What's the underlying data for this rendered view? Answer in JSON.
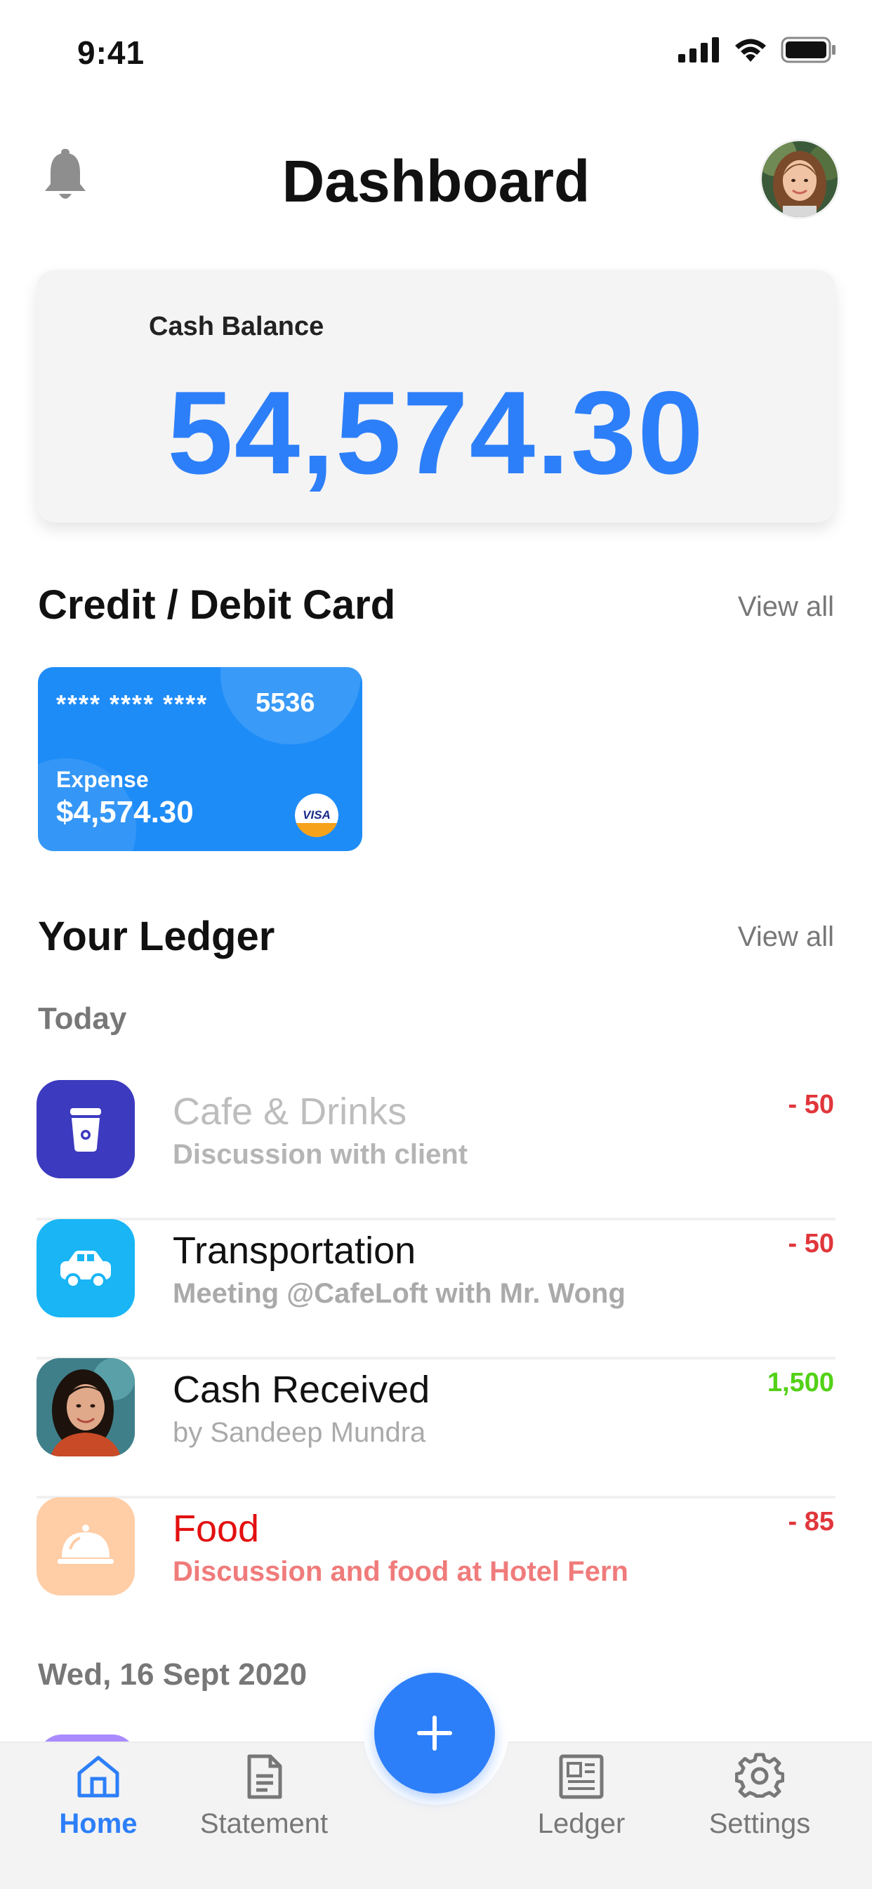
{
  "status_bar": {
    "time": "9:41"
  },
  "header": {
    "title": "Dashboard"
  },
  "balance": {
    "label": "Cash Balance",
    "value": "54,574.30"
  },
  "cards_section": {
    "title": "Credit / Debit Card",
    "view_all": "View all",
    "card": {
      "masked": "**** **** ****",
      "last4": "5536",
      "expense_label": "Expense",
      "expense_value": "$4,574.30",
      "network": "VISA"
    }
  },
  "ledger_section": {
    "title": "Your Ledger",
    "view_all": "View all",
    "groups": [
      {
        "label": "Today",
        "items": [
          {
            "title": "Cafe & Drinks",
            "subtitle": "Discussion with client",
            "amount": "- 50",
            "icon": "coffee-cup-icon"
          },
          {
            "title": "Transportation",
            "subtitle": "Meeting @CafeLoft with Mr. Wong",
            "amount": "- 50",
            "icon": "car-icon"
          },
          {
            "title": "Cash Received",
            "subtitle": "by Sandeep Mundra",
            "amount": "1,500",
            "icon": "person-avatar"
          },
          {
            "title": "Food",
            "subtitle": "Discussion and food at Hotel Fern",
            "amount": "- 85",
            "icon": "cloche-icon"
          }
        ]
      },
      {
        "label": "Wed, 16 Sept 2020",
        "items": []
      }
    ]
  },
  "bottom_nav": {
    "items": [
      {
        "label": "Home",
        "icon": "home-icon",
        "active": true
      },
      {
        "label": "Statement",
        "icon": "document-icon",
        "active": false
      },
      {
        "label": "Ledger",
        "icon": "newspaper-icon",
        "active": false
      },
      {
        "label": "Settings",
        "icon": "gear-icon",
        "active": false
      }
    ],
    "fab_icon": "plus-icon"
  },
  "colors": {
    "accent": "#2d7ff9",
    "negative": "#e0363b",
    "positive": "#53d116",
    "cafe_icon_bg": "#3c3abf",
    "transport_icon_bg": "#19b5f5",
    "food_icon_bg": "#ffcda6",
    "card_bg": "#1e8cf7"
  }
}
